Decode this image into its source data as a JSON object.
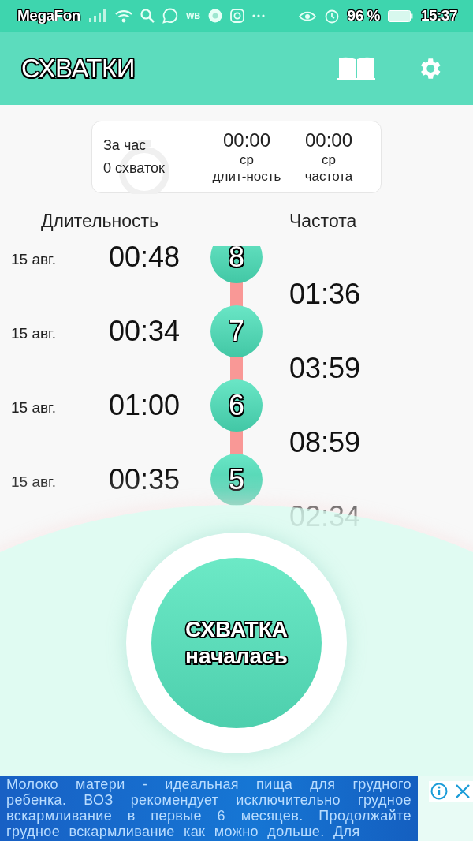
{
  "status_bar": {
    "carrier": "MegaFon",
    "wb": "WB",
    "battery": "96 %",
    "time": "15:37"
  },
  "app_bar": {
    "title": "СХВАТКИ"
  },
  "summary": {
    "period_label": "За час",
    "count": "0 схваток",
    "stats": [
      {
        "value": "00:00",
        "line1": "ср",
        "line2": "длит-ность"
      },
      {
        "value": "00:00",
        "line1": "ср",
        "line2": "частота"
      }
    ]
  },
  "columns": {
    "duration": "Длительность",
    "frequency": "Частота"
  },
  "contractions": [
    {
      "number": "8",
      "date": "15 авг.",
      "duration": "00:48"
    },
    {
      "number": "7",
      "date": "15 авг.",
      "duration": "00:34"
    },
    {
      "number": "6",
      "date": "15 авг.",
      "duration": "01:00"
    },
    {
      "number": "5",
      "date": "15 авг.",
      "duration": "00:35"
    }
  ],
  "intervals": [
    "01:36",
    "03:59",
    "08:59",
    "02:34"
  ],
  "start_button": {
    "line1": "СХВАТКА",
    "line2": "началась"
  },
  "ad": {
    "text": "Молоко матери - идеальная пища для грудного ребенка. ВОЗ рекомендует исключительно грудное вскармливание в первые 6 месяцев. Продолжайте грудное вскармливание как можно дольше. Для"
  }
}
